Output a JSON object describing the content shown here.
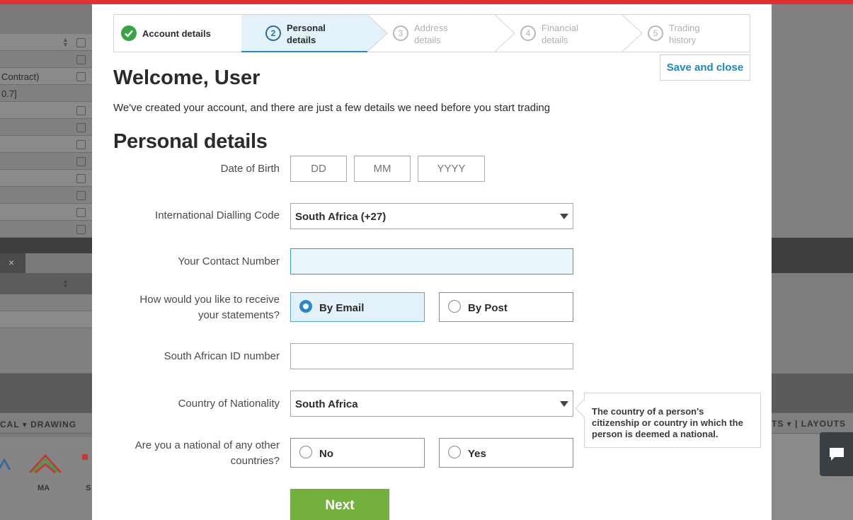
{
  "background": {
    "left_rows": [
      "",
      "",
      "Contract)",
      "0.7]",
      "",
      "",
      "",
      "",
      "",
      "",
      "",
      ""
    ],
    "left_toolbar_label": "CAL ▾   DRAWING",
    "left_icon_labels": [
      "MA",
      "S"
    ],
    "right_toolbar_label": "TS ▾ | LAYOUTS",
    "close_glyph": "×"
  },
  "stepper": {
    "steps": [
      {
        "number": "✓",
        "line1": "Account details",
        "line2": ""
      },
      {
        "number": "2",
        "line1": "Personal",
        "line2": "details"
      },
      {
        "number": "3",
        "line1": "Address",
        "line2": "details"
      },
      {
        "number": "4",
        "line1": "Financial",
        "line2": "details"
      },
      {
        "number": "5",
        "line1": "Trading",
        "line2": "history"
      }
    ]
  },
  "header": {
    "save_close": "Save and close",
    "welcome": "Welcome, User",
    "intro": "We've created your account, and there are just a few details we need before you start trading",
    "section_title": "Personal details"
  },
  "form": {
    "dob": {
      "label": "Date of Birth",
      "dd": "DD",
      "mm": "MM",
      "yyyy": "YYYY"
    },
    "dialling": {
      "label": "International Dialling Code",
      "value": "South Africa (+27)"
    },
    "contact": {
      "label": "Your Contact Number",
      "value": ""
    },
    "statements": {
      "label1": "How would you like to receive",
      "label2": "your statements?",
      "option_email": "By Email",
      "option_post": "By Post"
    },
    "id_number": {
      "label": "South African ID number",
      "value": ""
    },
    "nationality": {
      "label": "Country of Nationality",
      "value": "South Africa",
      "tooltip": "The country of a person's citizenship or country in which the person is deemed a national."
    },
    "other_national": {
      "label1": "Are you a national of any other",
      "label2": "countries?",
      "option_no": "No",
      "option_yes": "Yes"
    },
    "next": "Next"
  }
}
